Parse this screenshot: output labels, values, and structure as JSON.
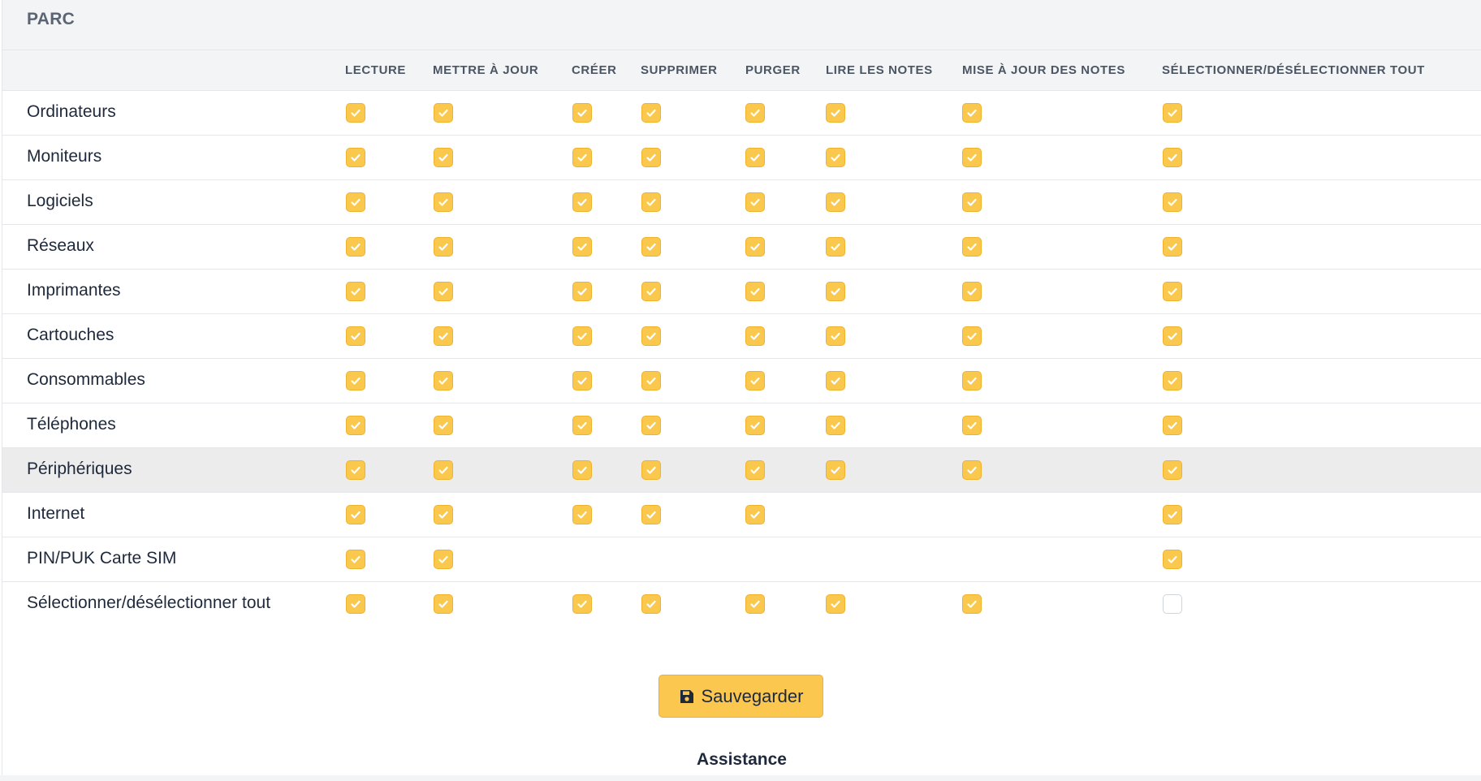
{
  "section": {
    "title": "PARC"
  },
  "columns": [
    "LECTURE",
    "METTRE À JOUR",
    "CRÉER",
    "SUPPRIMER",
    "PURGER",
    "LIRE LES NOTES",
    "MISE À JOUR DES NOTES",
    "SÉLECTIONNER/DÉSÉLECTIONNER TOUT"
  ],
  "rows": [
    {
      "label": "Ordinateurs",
      "checks": [
        true,
        true,
        true,
        true,
        true,
        true,
        true,
        true
      ]
    },
    {
      "label": "Moniteurs",
      "checks": [
        true,
        true,
        true,
        true,
        true,
        true,
        true,
        true
      ]
    },
    {
      "label": "Logiciels",
      "checks": [
        true,
        true,
        true,
        true,
        true,
        true,
        true,
        true
      ]
    },
    {
      "label": "Réseaux",
      "checks": [
        true,
        true,
        true,
        true,
        true,
        true,
        true,
        true
      ]
    },
    {
      "label": "Imprimantes",
      "checks": [
        true,
        true,
        true,
        true,
        true,
        true,
        true,
        true
      ]
    },
    {
      "label": "Cartouches",
      "checks": [
        true,
        true,
        true,
        true,
        true,
        true,
        true,
        true
      ]
    },
    {
      "label": "Consommables",
      "checks": [
        true,
        true,
        true,
        true,
        true,
        true,
        true,
        true
      ]
    },
    {
      "label": "Téléphones",
      "checks": [
        true,
        true,
        true,
        true,
        true,
        true,
        true,
        true
      ]
    },
    {
      "label": "Périphériques",
      "checks": [
        true,
        true,
        true,
        true,
        true,
        true,
        true,
        true
      ],
      "highlighted": true
    },
    {
      "label": "Internet",
      "checks": [
        true,
        true,
        true,
        true,
        true,
        null,
        null,
        true
      ]
    },
    {
      "label": "PIN/PUK Carte SIM",
      "checks": [
        true,
        true,
        null,
        null,
        null,
        null,
        null,
        true
      ]
    },
    {
      "label": "Sélectionner/désélectionner tout",
      "checks": [
        true,
        true,
        true,
        true,
        true,
        true,
        true,
        false
      ]
    }
  ],
  "save_button": {
    "label": "Sauvegarder",
    "icon": "floppy-disk-icon"
  },
  "next_section": {
    "title": "Assistance"
  },
  "colors": {
    "accent": "#fcc74f",
    "header_bg": "#f3f4f6",
    "highlight_row": "#ececec"
  }
}
